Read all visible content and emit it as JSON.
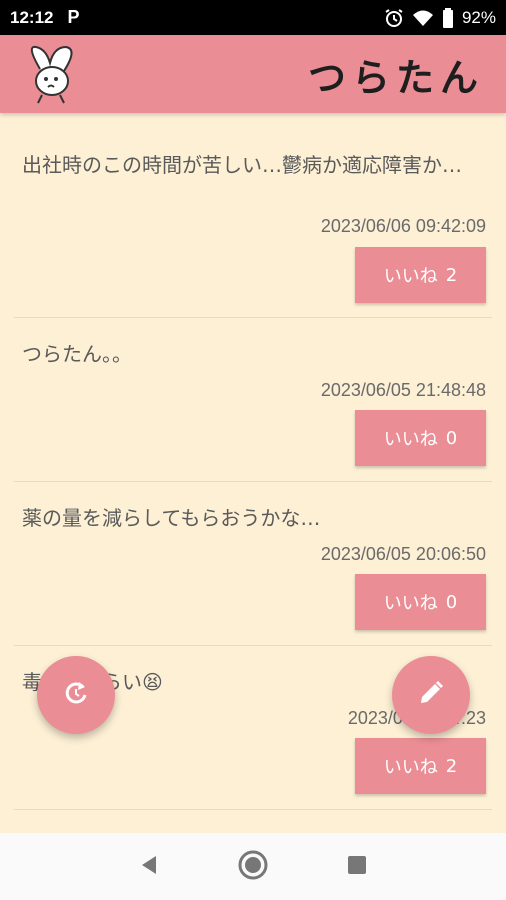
{
  "status_bar": {
    "time": "12:12",
    "notification_letter": "P",
    "battery": "92%"
  },
  "app": {
    "title": "つらたん",
    "accent_color": "#eb8d95",
    "background_color": "#fdf0d5"
  },
  "posts": [
    {
      "text": "出社時のこの時間が苦しい…鬱病か適応障害か…",
      "date": "2023/06/06 09:42:09",
      "like_label": "いいね",
      "like_count": "2"
    },
    {
      "text": "つらたん。。",
      "date": "2023/06/05 21:48:48",
      "like_label": "いいね",
      "like_count": "0"
    },
    {
      "text": "薬の量を減らしてもらおうかな…",
      "date": "2023/06/05 20:06:50",
      "like_label": "いいね",
      "like_count": "0"
    },
    {
      "text": "毒…きづらい😫",
      "date": "2023/06/05 …:23",
      "like_label": "いいね",
      "like_count": "2"
    }
  ],
  "fabs": {
    "refresh_icon": "refresh-icon",
    "compose_icon": "pencil-icon"
  },
  "nav": {
    "back_icon": "back-triangle-icon",
    "home_icon": "home-circle-icon",
    "recents_icon": "recents-square-icon"
  }
}
